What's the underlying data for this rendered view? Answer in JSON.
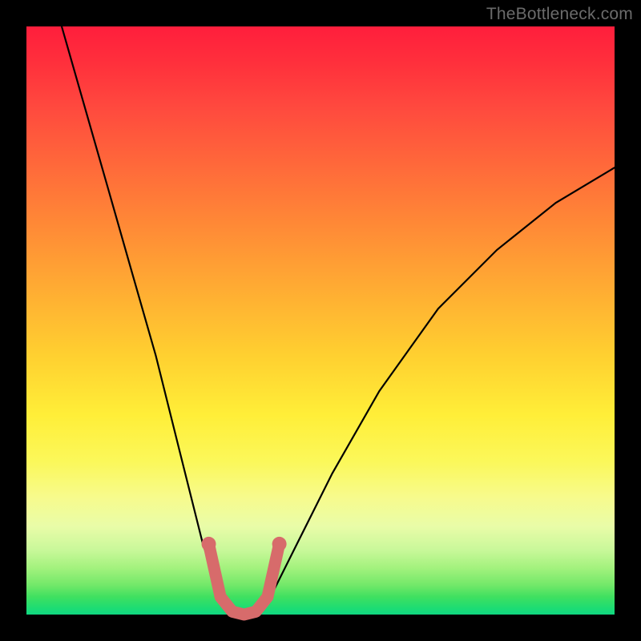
{
  "watermark": "TheBottleneck.com",
  "chart_data": {
    "type": "line",
    "title": "",
    "xlabel": "",
    "ylabel": "",
    "xlim": [
      0,
      100
    ],
    "ylim": [
      0,
      100
    ],
    "grid": false,
    "legend": false,
    "background_gradient": {
      "stops": [
        {
          "pos": 0,
          "color": "#ff1e3c"
        },
        {
          "pos": 24,
          "color": "#ff6a3a"
        },
        {
          "pos": 56,
          "color": "#ffd030"
        },
        {
          "pos": 80,
          "color": "#f7fb8c"
        },
        {
          "pos": 95,
          "color": "#72e869"
        },
        {
          "pos": 100,
          "color": "#10d882"
        }
      ]
    },
    "series": [
      {
        "name": "bottleneck-curve",
        "color": "#000000",
        "x": [
          6,
          10,
          14,
          18,
          22,
          26,
          28,
          30,
          32,
          33,
          34,
          36,
          38,
          40,
          42,
          46,
          52,
          60,
          70,
          80,
          90,
          100
        ],
        "y": [
          100,
          86,
          72,
          58,
          44,
          28,
          20,
          12,
          6,
          3,
          1,
          0,
          0,
          1,
          4,
          12,
          24,
          38,
          52,
          62,
          70,
          76
        ]
      }
    ],
    "accent_segment": {
      "name": "bottom-marker",
      "color": "#d76b6b",
      "x": [
        31,
        33,
        35,
        37,
        39,
        41,
        43
      ],
      "y": [
        12,
        3,
        0.5,
        0,
        0.5,
        3,
        12
      ]
    },
    "accent_dots": [
      {
        "x": 31,
        "y": 12
      },
      {
        "x": 43,
        "y": 12
      }
    ]
  }
}
